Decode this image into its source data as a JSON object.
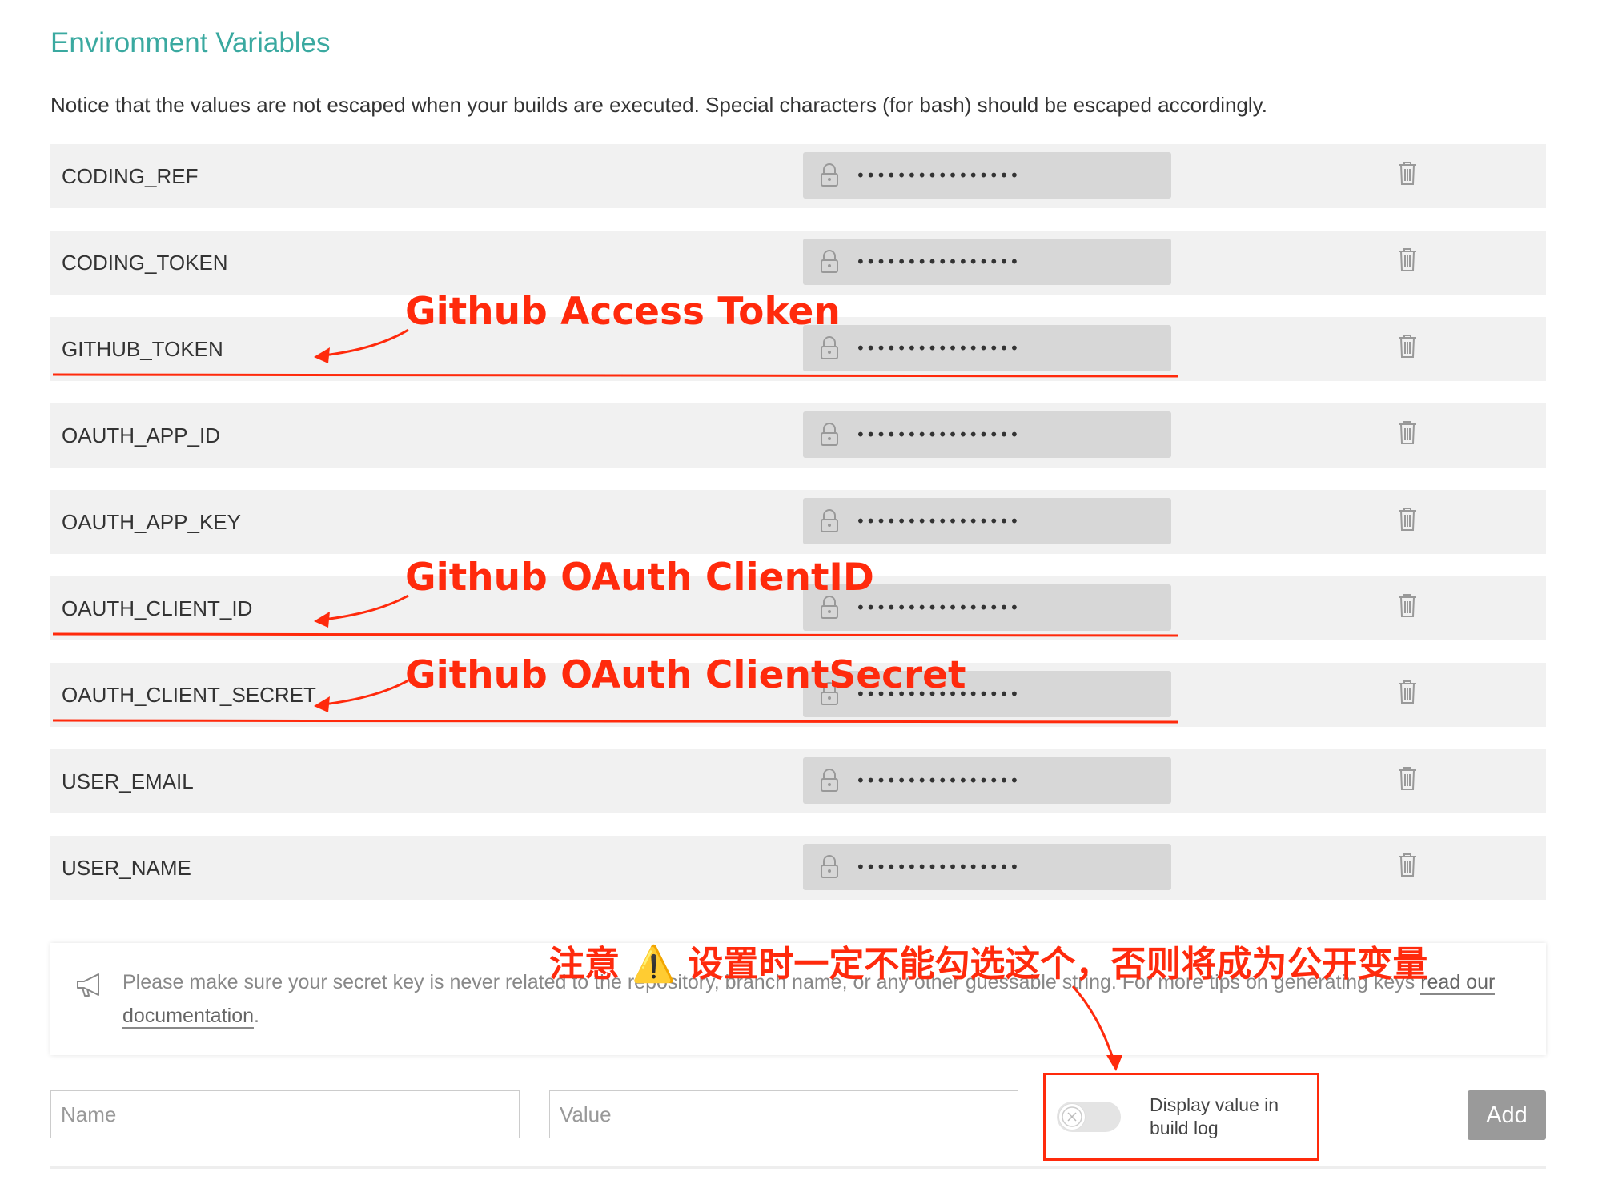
{
  "page": {
    "title": "Environment Variables",
    "notice": "Notice that the values are not escaped when your builds are executed. Special characters (for bash) should be escaped accordingly."
  },
  "variables": [
    {
      "name": "CODING_REF",
      "masked_value": "••••••••••••••••"
    },
    {
      "name": "CODING_TOKEN",
      "masked_value": "••••••••••••••••"
    },
    {
      "name": "GITHUB_TOKEN",
      "masked_value": "••••••••••••••••"
    },
    {
      "name": "OAUTH_APP_ID",
      "masked_value": "••••••••••••••••"
    },
    {
      "name": "OAUTH_APP_KEY",
      "masked_value": "••••••••••••••••"
    },
    {
      "name": "OAUTH_CLIENT_ID",
      "masked_value": "••••••••••••••••"
    },
    {
      "name": "OAUTH_CLIENT_SECRET",
      "masked_value": "••••••••••••••••"
    },
    {
      "name": "USER_EMAIL",
      "masked_value": "••••••••••••••••"
    },
    {
      "name": "USER_NAME",
      "masked_value": "••••••••••••••••"
    }
  ],
  "icons": {
    "lock": "lock-icon",
    "trash": "trash-icon",
    "megaphone": "megaphone-icon",
    "toggle_off": "close-icon"
  },
  "tip": {
    "text": "Please make sure your secret key is never related to the repository, branch name, or any other guessable string. For more tips on generating keys ",
    "link_text": "read our documentation",
    "suffix": "."
  },
  "form": {
    "name_placeholder": "Name",
    "value_placeholder": "Value",
    "toggle_label": "Display value in build log",
    "toggle_on": false,
    "add_label": "Add"
  },
  "annotations": {
    "github_token": "Github Access Token",
    "client_id": "Github OAuth ClientID",
    "client_secret": "Github OAuth ClientSecret",
    "warning": "注意 ⚠️ 设置时一定不能勾选这个，否则将成为公开变量"
  },
  "colors": {
    "accent": "#3aa9a0",
    "annotation": "#ff2a0c",
    "row_bg": "#f1f1f1",
    "value_bg": "#d7d7d7",
    "add_button": "#9a9a9a"
  }
}
